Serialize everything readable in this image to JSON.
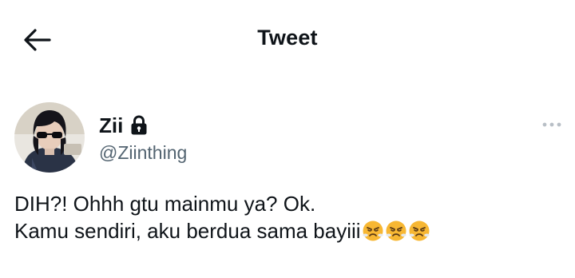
{
  "header": {
    "title": "Tweet",
    "back_icon": "arrow-left-icon"
  },
  "tweet": {
    "display_name": "Zii",
    "protected_icon": "lock-icon",
    "handle": "@Ziinthing",
    "more_icon": "ellipsis-icon",
    "text_line_1": "DIH?! Ohhh gtu mainmu ya? Ok.",
    "text_line_2": "Kamu sendiri, aku berdua sama bayiii",
    "emojis": [
      "face-with-steam-from-nose",
      "face-with-steam-from-nose",
      "face-with-steam-from-nose"
    ]
  },
  "colors": {
    "text_primary": "#0f1419",
    "text_secondary": "#536471",
    "background": "#ffffff",
    "emoji_yellow": "#f7b733"
  }
}
